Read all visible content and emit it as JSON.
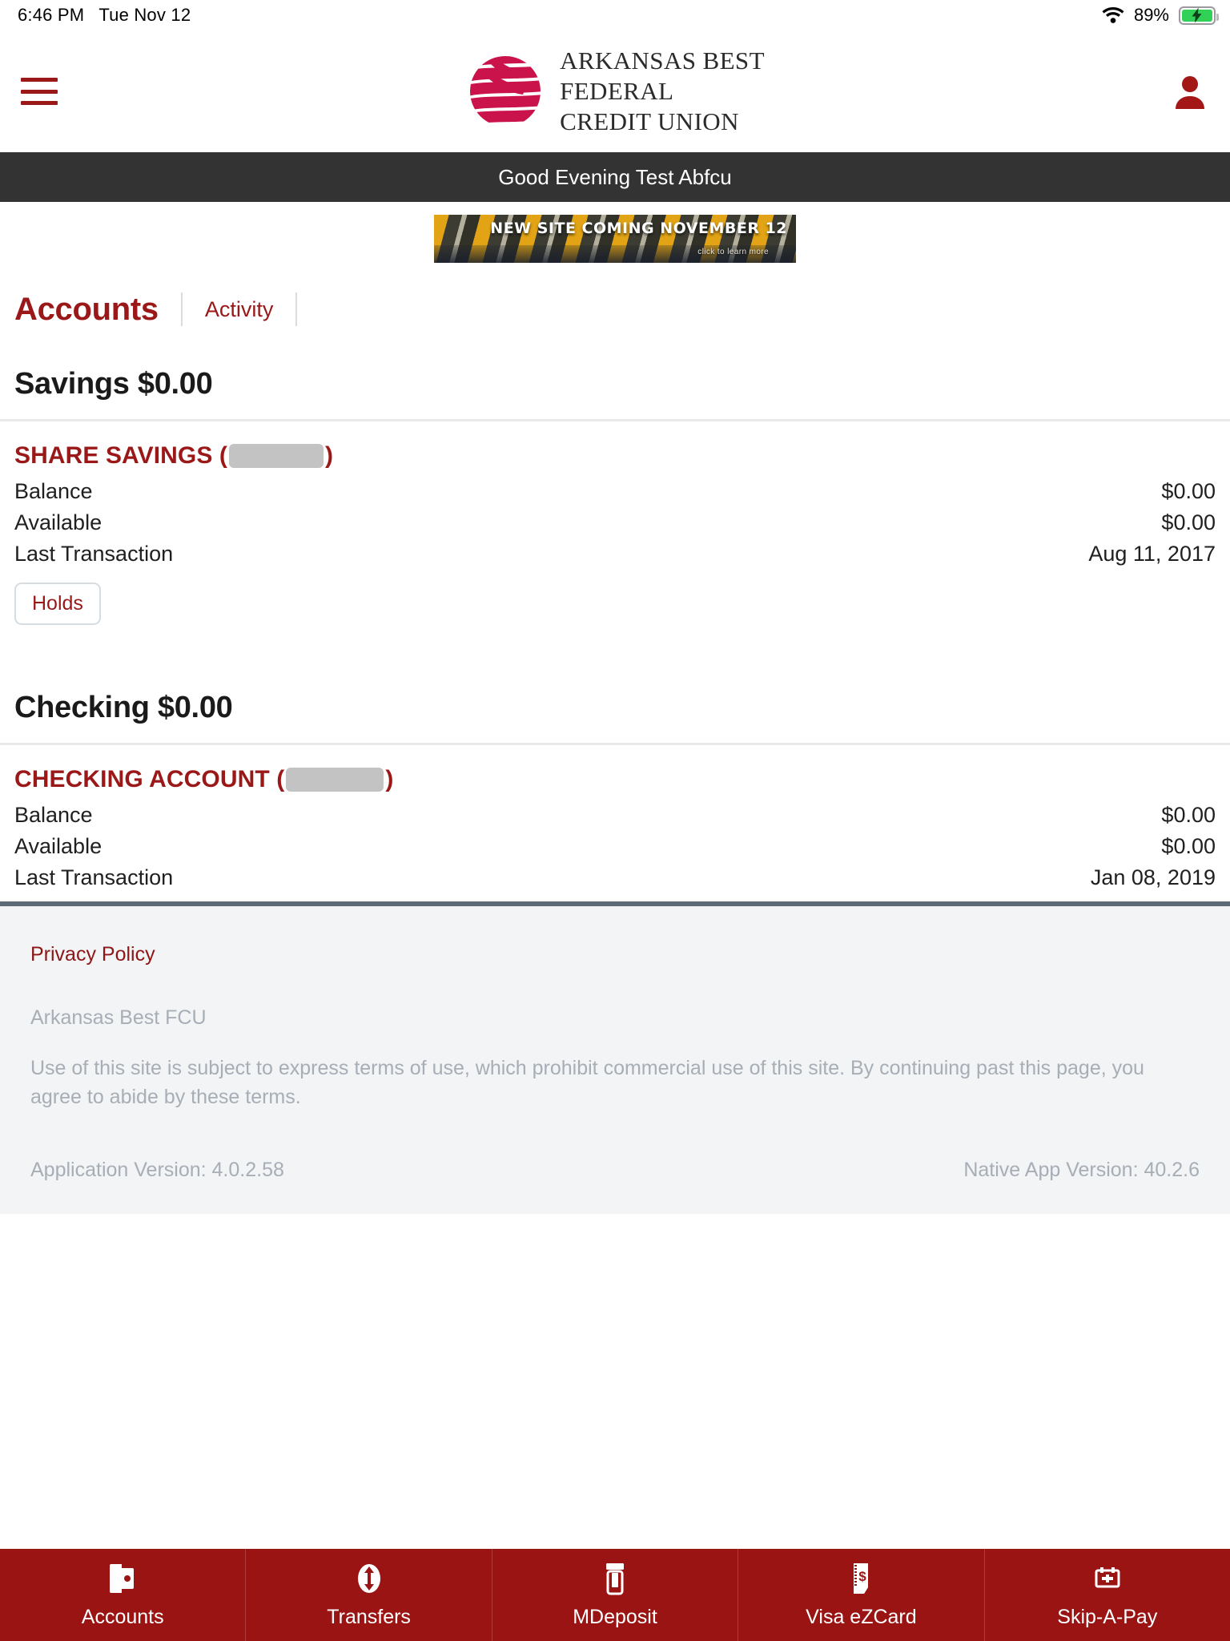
{
  "statusbar": {
    "time": "6:46 PM",
    "date": "Tue Nov 12",
    "battery_percent": "89%",
    "wifi_icon": "wifi-icon",
    "battery_icon": "battery-charging-icon"
  },
  "header": {
    "menu_icon": "hamburger-menu-icon",
    "logo_icon": "abfcu-globe-logo-icon",
    "logo_line1": "ARKANSAS BEST",
    "logo_line2": "FEDERAL",
    "logo_line3": "CREDIT UNION",
    "profile_icon": "user-profile-icon",
    "brand_color": "#9B1818"
  },
  "greeting": {
    "text": "Good Evening Test Abfcu",
    "background": "#333333"
  },
  "banner": {
    "title": "NEW SITE COMING NOVEMBER 12",
    "subtitle": "click to learn more"
  },
  "tabs": {
    "primary": "Accounts",
    "secondary": "Activity"
  },
  "groups": [
    {
      "title": "Savings $0.00",
      "accounts": [
        {
          "name": "SHARE SAVINGS",
          "number_redacted": true,
          "rows": [
            {
              "label": "Balance",
              "value": "$0.00"
            },
            {
              "label": "Available",
              "value": "$0.00"
            },
            {
              "label": "Last Transaction",
              "value": "Aug 11, 2017"
            }
          ],
          "action_label": "Holds"
        }
      ]
    },
    {
      "title": "Checking $0.00",
      "accounts": [
        {
          "name": "CHECKING ACCOUNT",
          "number_redacted": true,
          "rows": [
            {
              "label": "Balance",
              "value": "$0.00"
            },
            {
              "label": "Available",
              "value": "$0.00"
            },
            {
              "label": "Last Transaction",
              "value": "Jan 08, 2019"
            }
          ],
          "action_label": null
        }
      ]
    }
  ],
  "footer": {
    "privacy_policy": "Privacy Policy",
    "org": "Arkansas Best FCU",
    "terms": "Use of this site is subject to express terms of use, which prohibit commercial use of this site. By continuing past this page, you agree to abide by these terms.",
    "app_version": "Application Version: 4.0.2.58",
    "native_version": "Native App Version: 40.2.6"
  },
  "tabbar": {
    "background": "#9B1414",
    "items": [
      {
        "label": "Accounts",
        "icon": "card-wallet-icon"
      },
      {
        "label": "Transfers",
        "icon": "transfer-arrows-icon"
      },
      {
        "label": "MDeposit",
        "icon": "check-deposit-icon"
      },
      {
        "label": "Visa eZCard",
        "icon": "dollar-receipt-icon"
      },
      {
        "label": "Skip-A-Pay",
        "icon": "calendar-skip-icon"
      }
    ]
  }
}
